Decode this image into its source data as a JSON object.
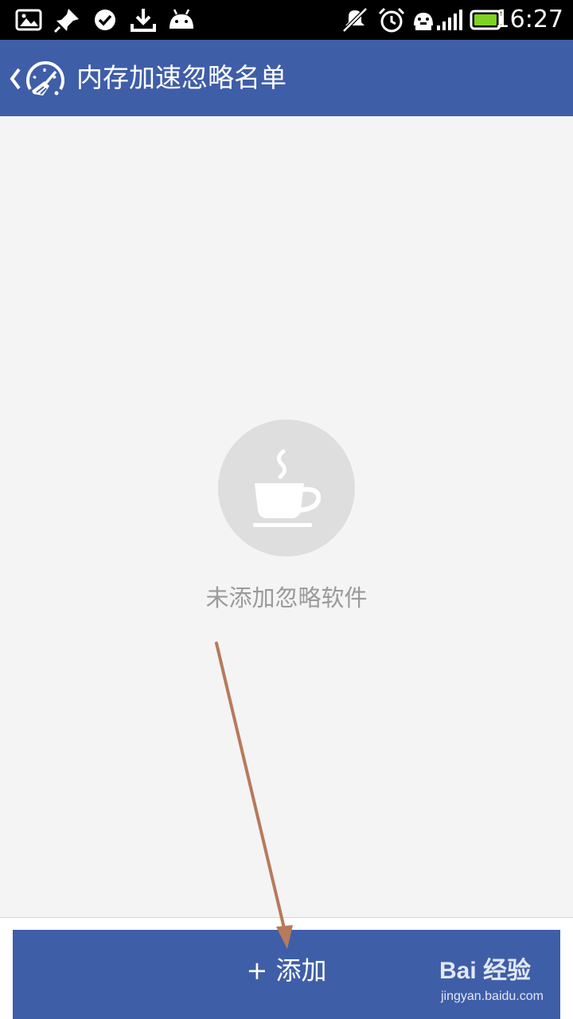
{
  "status_bar": {
    "time": "16:27",
    "left_icons": [
      "gallery-icon",
      "pin-icon",
      "check-circle-icon",
      "download-icon",
      "android-icon"
    ],
    "right_icons": [
      "mute-icon",
      "alarm-icon",
      "usb-debug-icon",
      "signal-icon",
      "battery-icon"
    ]
  },
  "header": {
    "title": "内存加速忽略名单",
    "background": "#3f5ea8"
  },
  "empty_state": {
    "icon": "coffee-cup-icon",
    "message": "未添加忽略软件"
  },
  "footer": {
    "add_button_label": "+ 添加",
    "button_color": "#3f5ea8"
  },
  "annotation": {
    "arrow_color": "#b87a5a"
  },
  "watermark": {
    "brand": "Bai 经验",
    "url": "jingyan.baidu.com"
  }
}
